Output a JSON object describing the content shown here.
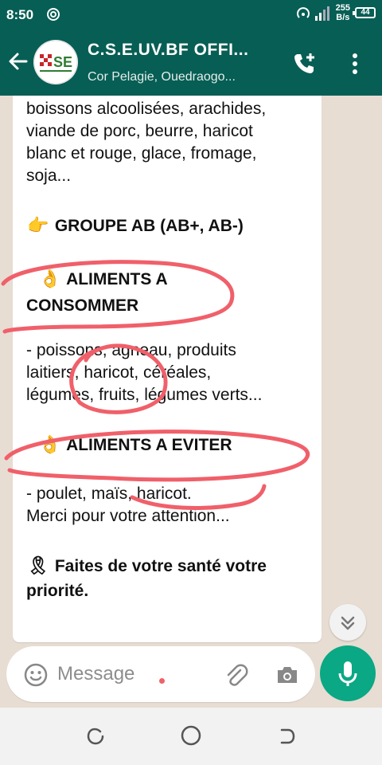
{
  "status_bar": {
    "time": "8:50",
    "network_speed_value": "255",
    "network_speed_unit": "B/s",
    "battery": "44"
  },
  "header": {
    "title": "C.S.E.UV.BF OFFI...",
    "subtitle": "Cor Pelagie, Ouedraogo...",
    "avatar_text": "SE",
    "call_icon": "add-call-icon",
    "menu_icon": "more-vert-icon"
  },
  "message": {
    "lines_top": [
      "boissons alcoolisées, arachides,",
      "viande de porc, beurre, haricot",
      "blanc et rouge, glace, fromage,",
      "soja..."
    ],
    "group_title": "GROUPE AB (AB+, AB-)",
    "consume_heading_line1": "ALIMENTS A",
    "consume_heading_line2": "CONSOMMER",
    "consume_lines": [
      "- poissons, agneau, produits",
      "laitiers, haricot, céréales,",
      "légumes, fruits, légumes verts..."
    ],
    "avoid_heading": "ALIMENTS A EVITER",
    "avoid_lines": [
      "- poulet, maïs, haricot.",
      "Merci pour votre attention..."
    ],
    "closing_line1": "Faites de votre santé votre",
    "closing_line2": "priorité.",
    "emojis": {
      "pointing": "👉",
      "ok_hand": "👌",
      "ribbon": "🎗"
    }
  },
  "composer": {
    "placeholder": "Message"
  },
  "colors": {
    "app_bar": "#075e54",
    "mic_button": "#0aa884",
    "annotation": "#f0606a"
  }
}
